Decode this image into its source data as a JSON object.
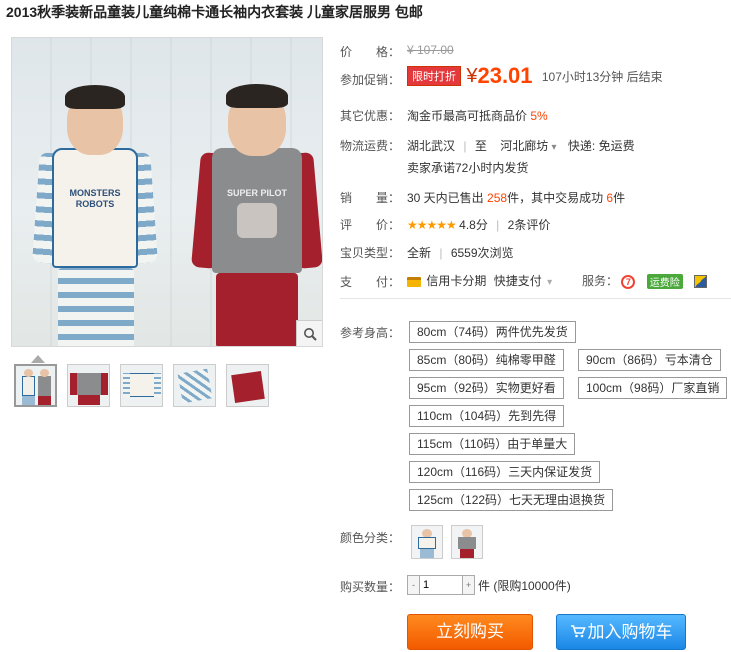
{
  "title": "2013秋季装新品童装儿童纯棉卡通长袖内衣套装 儿童家居服男 包邮",
  "price": {
    "label": "价　　格：",
    "original": "¥ 107.00"
  },
  "promo": {
    "label": "参加促销：",
    "tag": "限时打折",
    "yen": "¥",
    "price": "23.01",
    "countdown": "107小时13分钟 后结束"
  },
  "other": {
    "label": "其它优惠：",
    "text": "淘金币最高可抵商品价",
    "pct": "5%"
  },
  "shipping": {
    "label": "物流运费：",
    "from": "湖北武汉",
    "sep": "|",
    "to": "至",
    "dest": "河北廊坊",
    "dest_arrow": "▾",
    "express": "快递: 免运费",
    "promise": "卖家承诺72小时内发货"
  },
  "sales": {
    "label": "销　　量：",
    "text1": "30 天内已售出",
    "sold": "258",
    "text2": "件，其中交易成功",
    "success": "6",
    "text3": "件"
  },
  "rating": {
    "label": "评　　价：",
    "stars": "★★★★★",
    "score": "4.8分",
    "sep": "|",
    "reviews": "2条评价"
  },
  "item_type": {
    "label": "宝贝类型：",
    "type": "全新",
    "sep": "|",
    "views": "6559次浏览"
  },
  "payment": {
    "label": "支　　付：",
    "credit": "信用卡分期",
    "fast": "快捷支付",
    "fast_arrow": "▾",
    "service_label": "服务：",
    "badge_7": "7",
    "badge_insurance": "运费险"
  },
  "size": {
    "label": "参考身高：",
    "options": [
      "80cm（74码）两件优先发货",
      "85cm（80码）纯棉零甲醛",
      "90cm（86码）亏本清仓",
      "95cm（92码）实物更好看",
      "100cm（98码）厂家直销",
      "110cm（104码）先到先得",
      "115cm（110码）由于单量大",
      "120cm（116码）三天内保证发货",
      "125cm（122码）七天无理由退换货"
    ]
  },
  "color": {
    "label": "颜色分类："
  },
  "quantity": {
    "label": "购买数量：",
    "value": "1",
    "minus": "-",
    "plus": "+",
    "limit": "件 (限购10000件)"
  },
  "buttons": {
    "buy": "立刻购买",
    "cart": "加入购物车"
  },
  "colors": {
    "accent": "#ff4400",
    "buy": "#f35a00",
    "cart": "#1a87e6",
    "promo_tag": "#e4393c"
  }
}
